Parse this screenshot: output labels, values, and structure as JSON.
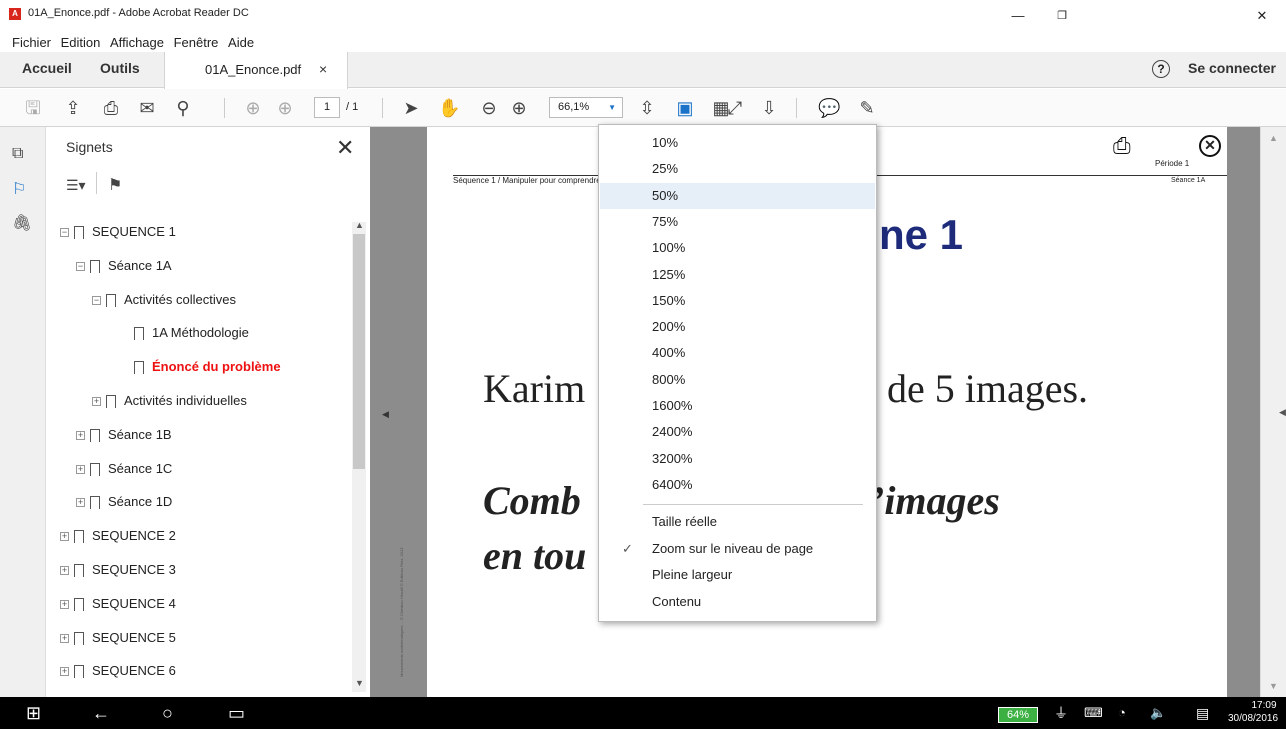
{
  "window": {
    "title": "01A_Enonce.pdf - Adobe Acrobat Reader DC"
  },
  "menu": [
    "Fichier",
    "Edition",
    "Affichage",
    "Fenêtre",
    "Aide"
  ],
  "tabs": {
    "home": "Accueil",
    "tools": "Outils",
    "doc": "01A_Enonce.pdf",
    "help": "?",
    "signin": "Se connecter"
  },
  "toolbar": {
    "page_current": "1",
    "page_total": "/ 1",
    "zoom": "66,1%"
  },
  "bookmarks": {
    "title": "Signets",
    "items": [
      {
        "label": "SEQUENCE 1",
        "level": 0,
        "toggle": "−"
      },
      {
        "label": "Séance 1A",
        "level": 1,
        "toggle": "−"
      },
      {
        "label": "Activités collectives",
        "level": 2,
        "toggle": "−"
      },
      {
        "label": "1A Méthodologie",
        "level": 3,
        "toggle": ""
      },
      {
        "label": "Énoncé du problème",
        "level": 3,
        "toggle": "",
        "active": true
      },
      {
        "label": "Activités individuelles",
        "level": 2,
        "toggle": "+"
      },
      {
        "label": "Séance 1B",
        "level": 1,
        "toggle": "+"
      },
      {
        "label": "Séance 1C",
        "level": 1,
        "toggle": "+"
      },
      {
        "label": "Séance 1D",
        "level": 1,
        "toggle": "+"
      },
      {
        "label": "SEQUENCE 2",
        "level": 0,
        "toggle": "+"
      },
      {
        "label": "SEQUENCE 3",
        "level": 0,
        "toggle": "+"
      },
      {
        "label": "SEQUENCE 4",
        "level": 0,
        "toggle": "+"
      },
      {
        "label": "SEQUENCE 5",
        "level": 0,
        "toggle": "+"
      },
      {
        "label": "SEQUENCE 6",
        "level": 0,
        "toggle": "+"
      }
    ]
  },
  "document": {
    "header_left": "Séquence 1  /  Manipuler pour comprendre la",
    "periode": "Période 1",
    "seance": "Séance 1A",
    "title_fragment": "ne 1",
    "line1_left": "Karim",
    "line1_right": "de 5 images.",
    "line2_left": "Comb",
    "line2_right": "’images",
    "line3_left": "en tou",
    "side_text": "Mouvements mathématiques ... © Christian Henaff © Éditions Retz, 2013"
  },
  "zoom_menu": {
    "levels": [
      "10%",
      "25%",
      "50%",
      "75%",
      "100%",
      "125%",
      "150%",
      "200%",
      "400%",
      "800%",
      "1600%",
      "2400%",
      "3200%",
      "6400%"
    ],
    "highlighted": "50%",
    "options": [
      "Taille réelle",
      "Zoom sur le niveau de page",
      "Pleine largeur",
      "Contenu"
    ],
    "checked": "Zoom sur le niveau de page"
  },
  "taskbar": {
    "battery": "64%",
    "time": "17:09",
    "date": "30/08/2016"
  },
  "colors": {
    "accent_red": "#e11111",
    "title_blue": "#1d2b7a",
    "battery_green": "#3cb043"
  }
}
